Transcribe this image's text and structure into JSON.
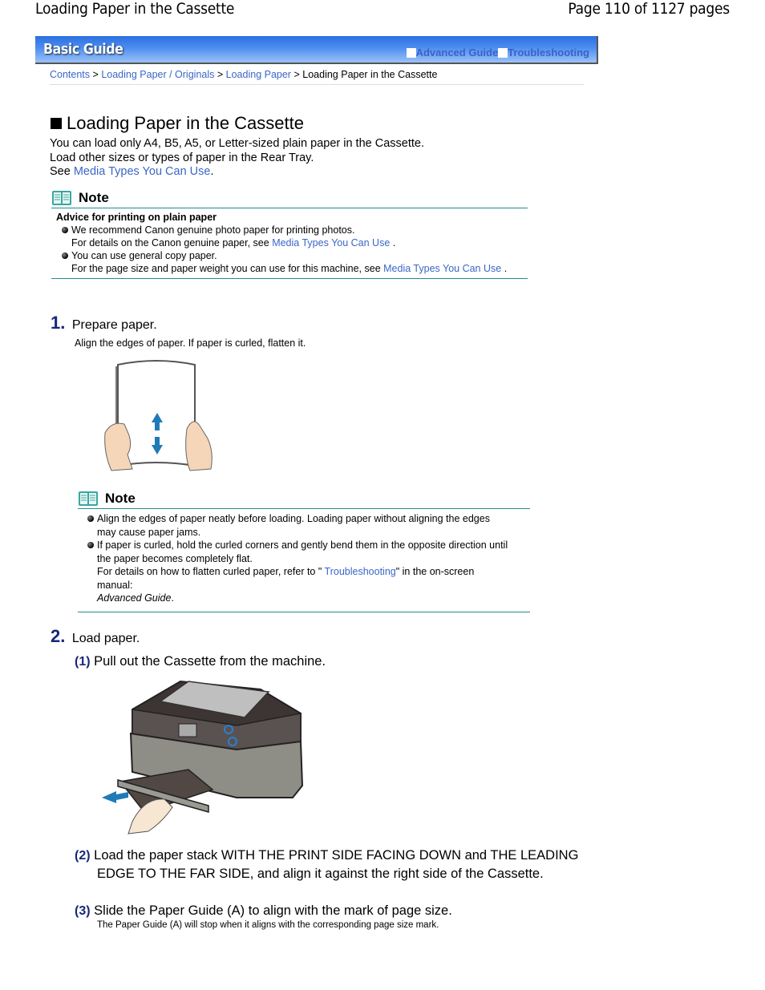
{
  "page_header": {
    "title": "Loading Paper in the Cassette",
    "page_info": "Page 110 of 1127 pages"
  },
  "banner": {
    "title": "Basic Guide",
    "links": [
      "Advanced Guide",
      "Troubleshooting"
    ],
    "colors": {
      "gradient_top": "#2b6fe0",
      "gradient_bottom": "#9cc2f7",
      "link": "#3a62c8"
    }
  },
  "breadcrumb": {
    "items": [
      "Contents",
      "Loading Paper / Originals",
      "Loading Paper"
    ],
    "separator": ">",
    "current": "Loading Paper in the Cassette"
  },
  "main": {
    "heading": "Loading Paper in the Cassette",
    "intro": {
      "line1": "You can load only A4, B5, A5, or Letter-sized plain paper in the Cassette.",
      "line2": "Load other sizes or types of paper in the Rear Tray.",
      "line3_prefix": "See ",
      "line3_link": "Media Types You Can Use",
      "line3_suffix": "."
    },
    "note1": {
      "label": "Note",
      "subheading": "Advice for printing on plain paper",
      "bullets": [
        {
          "text": "We recommend Canon genuine photo paper for printing photos.",
          "detail_prefix": "For details on the Canon genuine paper, see ",
          "detail_link": "Media Types You Can Use",
          "detail_suffix": "."
        },
        {
          "text": "You can use general copy paper.",
          "detail_prefix": "For the page size and paper weight you can use for this machine, see ",
          "detail_link": "Media Types You Can Use",
          "detail_suffix": "."
        }
      ]
    },
    "step1": {
      "number": "1.",
      "title": "Prepare paper.",
      "desc": "Align the edges of paper. If paper is curled, flatten it.",
      "note": {
        "label": "Note",
        "bullets": [
          {
            "text": "Align the edges of paper neatly before loading. Loading paper without aligning the edges may cause paper jams."
          },
          {
            "text": "If paper is curled, hold the curled corners and gently bend them in the opposite direction until the paper becomes completely flat.",
            "detail_prefix": "For details on how to flatten curled paper, refer to \" ",
            "detail_link": "Troubleshooting",
            "detail_suffix": "\" in the on-screen manual:",
            "detail_italic": "Advanced Guide",
            "detail_end": "."
          }
        ]
      }
    },
    "step2": {
      "number": "2.",
      "title": "Load paper.",
      "substeps": [
        {
          "num": "(1)",
          "text": "Pull out the Cassette from the machine."
        },
        {
          "num": "(2)",
          "text": "Load the paper stack WITH THE PRINT SIDE FACING DOWN and THE LEADING EDGE TO THE FAR SIDE, and align it against the right side of the Cassette."
        },
        {
          "num": "(3)",
          "text": "Slide the Paper Guide (A) to align with the mark of page size.",
          "desc": "The Paper Guide (A) will stop when it aligns with the corresponding page size mark."
        }
      ]
    }
  }
}
